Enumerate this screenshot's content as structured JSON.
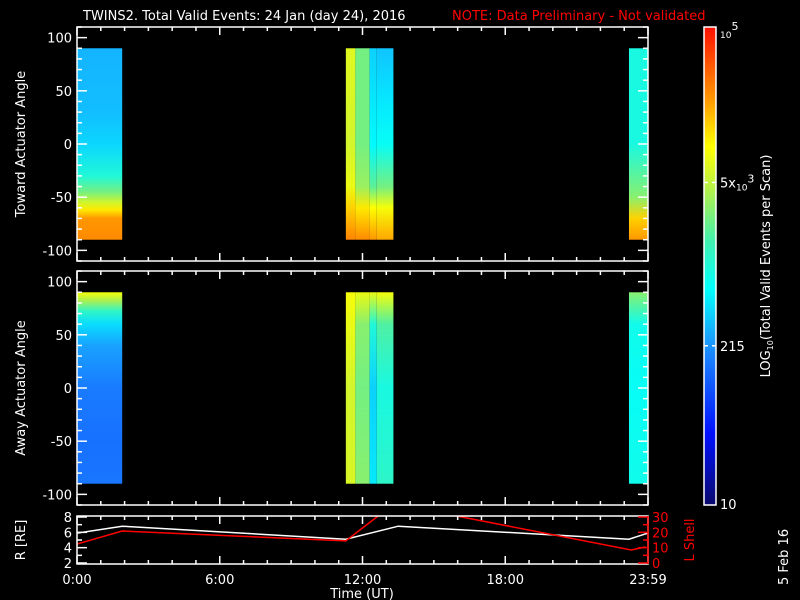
{
  "header": {
    "title": "TWINS2. Total Valid Events: 24 Jan (day  24), 2016",
    "note": "NOTE: Data Preliminary - Not validated"
  },
  "footer": {
    "date_stamp": "5 Feb 16"
  },
  "colors": {
    "note": "#ff0000",
    "axes": "#ffffff",
    "l_shell": "#ff0000",
    "r_line": "#ffffff"
  },
  "chart_data": [
    {
      "type": "heatmap",
      "panel": "toward",
      "ylabel": "Toward Actuator Angle",
      "ylim": [
        -110,
        110
      ],
      "xlim": [
        0,
        24
      ],
      "yticks": [
        "100",
        "50",
        "0",
        "-50",
        "-100"
      ],
      "ytick_values": [
        100,
        50,
        0,
        -50,
        -100
      ],
      "columns": [
        {
          "t": [
            0.0,
            1.9
          ],
          "profile": [
            [
              90,
              300
            ],
            [
              30,
              330
            ],
            [
              0,
              420
            ],
            [
              -30,
              1000
            ],
            [
              -45,
              2500
            ],
            [
              -55,
              6000
            ],
            [
              -62,
              12000
            ],
            [
              -70,
              25000
            ],
            [
              -90,
              28000
            ]
          ]
        },
        {
          "t": [
            11.3,
            11.7
          ],
          "profile": [
            [
              90,
              7000
            ],
            [
              0,
              6000
            ],
            [
              -40,
              8000
            ],
            [
              -60,
              15000
            ],
            [
              -90,
              30000
            ]
          ]
        },
        {
          "t": [
            11.7,
            12.3
          ],
          "profile": [
            [
              90,
              2500
            ],
            [
              0,
              2500
            ],
            [
              -40,
              3500
            ],
            [
              -60,
              12000
            ],
            [
              -90,
              28000
            ]
          ]
        },
        {
          "t": [
            12.3,
            12.6
          ],
          "profile": [
            [
              90,
              400
            ],
            [
              0,
              600
            ],
            [
              -40,
              2000
            ],
            [
              -60,
              10000
            ],
            [
              -90,
              25000
            ]
          ]
        },
        {
          "t": [
            12.6,
            13.3
          ],
          "profile": [
            [
              90,
              350
            ],
            [
              40,
              500
            ],
            [
              0,
              700
            ],
            [
              -40,
              2500
            ],
            [
              -60,
              9000
            ],
            [
              -90,
              22000
            ]
          ]
        },
        {
          "t": [
            23.2,
            24.0
          ],
          "profile": [
            [
              90,
              900
            ],
            [
              0,
              900
            ],
            [
              -50,
              3000
            ],
            [
              -70,
              15000
            ],
            [
              -90,
              25000
            ]
          ]
        }
      ]
    },
    {
      "type": "heatmap",
      "panel": "away",
      "ylabel": "Away Actuator Angle",
      "ylim": [
        -110,
        110
      ],
      "xlim": [
        0,
        24
      ],
      "yticks": [
        "100",
        "50",
        "0",
        "-50",
        "-100"
      ],
      "ytick_values": [
        100,
        50,
        0,
        -50,
        -100
      ],
      "columns": [
        {
          "t": [
            0.0,
            1.9
          ],
          "profile": [
            [
              90,
              9000
            ],
            [
              82,
              4000
            ],
            [
              72,
              1200
            ],
            [
              60,
              450
            ],
            [
              40,
              250
            ],
            [
              0,
              160
            ],
            [
              -50,
              140
            ],
            [
              -90,
              150
            ]
          ]
        },
        {
          "t": [
            11.3,
            11.7
          ],
          "profile": [
            [
              90,
              9000
            ],
            [
              0,
              6000
            ],
            [
              -90,
              6500
            ]
          ]
        },
        {
          "t": [
            11.7,
            12.3
          ],
          "profile": [
            [
              90,
              8000
            ],
            [
              60,
              3000
            ],
            [
              0,
              2500
            ],
            [
              -90,
              3000
            ]
          ]
        },
        {
          "t": [
            12.3,
            12.6
          ],
          "profile": [
            [
              90,
              8000
            ],
            [
              60,
              1000
            ],
            [
              0,
              400
            ],
            [
              -90,
              500
            ]
          ]
        },
        {
          "t": [
            12.6,
            13.3
          ],
          "profile": [
            [
              90,
              9000
            ],
            [
              60,
              1800
            ],
            [
              0,
              900
            ],
            [
              -90,
              1200
            ]
          ]
        },
        {
          "t": [
            23.2,
            24.0
          ],
          "profile": [
            [
              90,
              3000
            ],
            [
              60,
              800
            ],
            [
              0,
              700
            ],
            [
              -90,
              800
            ]
          ]
        }
      ]
    },
    {
      "type": "line",
      "panel": "orbit",
      "ylabel": "R [RE]",
      "y2label": "L Shell",
      "xlabel": "Time (UT)",
      "xlim": [
        0,
        24
      ],
      "xticks": [
        "0:00",
        "6:00",
        "12:00",
        "18:00",
        "23:59"
      ],
      "xtick_values": [
        0,
        6,
        12,
        18,
        24
      ],
      "ylim": [
        1.87,
        8.13
      ],
      "yticks": [
        "2",
        "4",
        "6",
        "8"
      ],
      "ytick_values": [
        2,
        4,
        6,
        8
      ],
      "y2lim": [
        -0.65,
        30.65
      ],
      "y2ticks": [
        "0",
        "10",
        "20",
        "30"
      ],
      "y2tick_values": [
        0,
        10,
        20,
        30
      ],
      "series": [
        {
          "name": "R",
          "axis": "left",
          "x": [
            0,
            1.9,
            11.3,
            13.5,
            23.2,
            24
          ],
          "y": [
            5.9,
            6.8,
            5.1,
            6.8,
            5.1,
            5.9
          ]
        },
        {
          "name": "L Shell",
          "axis": "right",
          "x": [
            0,
            1.9,
            11.3,
            13.32,
            23.3,
            23.9
          ],
          "y": [
            12.4,
            20.9,
            14.4,
            38.6,
            8.5,
            10.5
          ]
        }
      ]
    },
    {
      "type": "colorbar",
      "label_main": "LOG",
      "label_sub": "10",
      "label_rest": "(Total Valid Events per Scan)",
      "scale": "log",
      "range": [
        10,
        100000
      ],
      "ticks": [
        {
          "value": 100000,
          "base": "10",
          "exp": "5",
          "prefix": ""
        },
        {
          "value": 5000,
          "base": "10",
          "exp": "3",
          "prefix": "5x"
        },
        {
          "value": 215,
          "text": "215"
        },
        {
          "value": 10,
          "text": "10"
        }
      ]
    }
  ]
}
